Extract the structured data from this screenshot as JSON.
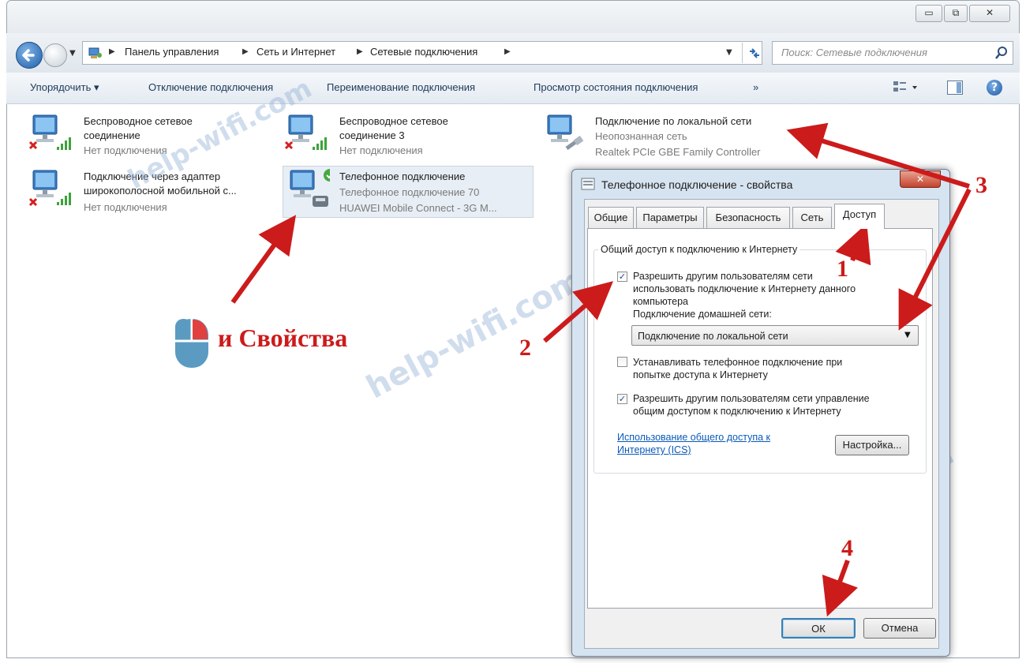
{
  "window": {
    "controls": {
      "minimize": "▭",
      "maximize": "⧉",
      "close": "✕"
    }
  },
  "address_bar": {
    "breadcrumb": [
      "Панель управления",
      "Сеть и Интернет",
      "Сетевые подключения"
    ],
    "search_placeholder": "Поиск: Сетевые подключения"
  },
  "toolbar": {
    "organize": "Упорядочить ▾",
    "disable": "Отключение подключения",
    "rename": "Переименование подключения",
    "status": "Просмотр состояния подключения",
    "more": "»"
  },
  "connections": [
    {
      "name_line1": "Беспроводное сетевое",
      "name_line2": "соединение",
      "status": "Нет подключения"
    },
    {
      "name_line1": "Беспроводное сетевое",
      "name_line2": "соединение 3",
      "status": "Нет подключения"
    },
    {
      "name": "Подключение по локальной сети",
      "network": "Неопознанная сеть",
      "device": "Realtek PCIe GBE Family Controller"
    },
    {
      "name_line1": "Подключение через адаптер",
      "name_line2": "широкополосной мобильной с...",
      "status": "Нет подключения"
    },
    {
      "name": "Телефонное подключение",
      "network": "Телефонное подключение 70",
      "device": "HUAWEI Mobile Connect - 3G M..."
    }
  ],
  "dialog": {
    "title": "Телефонное подключение - свойства",
    "close": "✕",
    "tabs": [
      "Общие",
      "Параметры",
      "Безопасность",
      "Сеть",
      "Доступ"
    ],
    "group_title": "Общий доступ к подключению к Интернету",
    "allow_sharing": {
      "line1": "Разрешить другим пользователям сети",
      "line2": "использовать подключение к Интернету данного",
      "line3": "компьютера",
      "checked": true
    },
    "home_network_label": "Подключение домашней сети:",
    "home_network_value": "Подключение по локальной сети",
    "dial_on_demand": {
      "line1": "Устанавливать телефонное подключение при",
      "line2": "попытке доступа к Интернету",
      "checked": false
    },
    "allow_control": {
      "line1": "Разрешить другим пользователям сети управление",
      "line2": "общим доступом к подключению к Интернету",
      "checked": true
    },
    "ics_link_line1": "Использование общего доступа к",
    "ics_link_line2": "Интернету (ICS)",
    "settings_button": "Настройка...",
    "ok_button": "ОК",
    "cancel_button": "Отмена"
  },
  "annotations": {
    "step1": "1",
    "step2": "2",
    "step3": "3",
    "step4": "4",
    "right_click_hint": "и Свойства",
    "color": "#cc1b1b"
  },
  "watermark": "help-wifi.com"
}
